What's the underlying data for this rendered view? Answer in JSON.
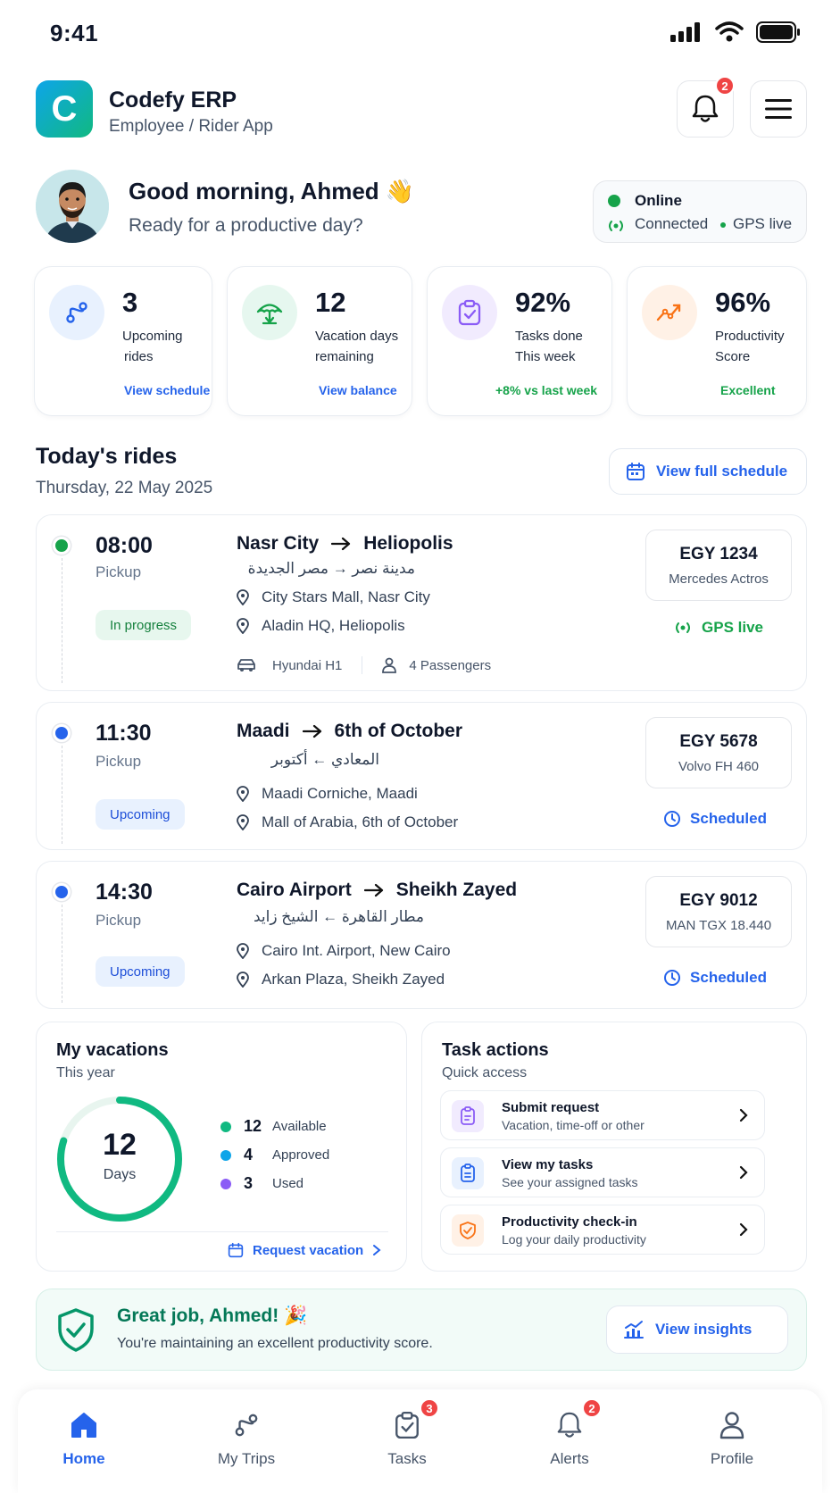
{
  "status_bar": {
    "time": "9:41"
  },
  "header": {
    "app_name": "Codefy ERP",
    "app_subtitle": "Employee / Rider App",
    "notification_count": "2",
    "logo_letter": "C"
  },
  "greeting": {
    "title": "Good morning, Ahmed 👋",
    "subtitle": "Ready for a productive day?"
  },
  "connection": {
    "status": "Online",
    "connected": "Connected",
    "gps": "GPS live"
  },
  "stats": [
    {
      "value": "3",
      "label_1": "Upcoming",
      "label_2": "rides",
      "link": "View schedule",
      "icon": "route-icon"
    },
    {
      "value": "12",
      "label_1": "Vacation days",
      "label_2": "remaining",
      "link": "View balance",
      "icon": "umbrella-icon"
    },
    {
      "value": "92%",
      "label_1": "Tasks done",
      "label_2": "This week",
      "link": "+8% vs last week",
      "icon": "clipboard-check-icon"
    },
    {
      "value": "96%",
      "label_1": "Productivity",
      "label_2": "Score",
      "link": "Excellent",
      "icon": "trend-icon"
    }
  ],
  "rides_section": {
    "title": "Today's rides",
    "date": "Thursday, 22 May 2025",
    "view_full": "View full schedule"
  },
  "rides": [
    {
      "time": "08:00",
      "pickup_label": "Pickup",
      "status": "In progress",
      "from": "Nasr City",
      "to": "Heliopolis",
      "arabic": "مدينة نصر → مصر الجديدة",
      "loc_from": "City Stars Mall, Nasr City",
      "loc_to": "Aladin HQ, Heliopolis",
      "vehicle": "Hyundai H1",
      "passengers": "4 Passengers",
      "plate": "EGY 1234",
      "truck": "Mercedes Actros",
      "tracking": "GPS live"
    },
    {
      "time": "11:30",
      "pickup_label": "Pickup",
      "status": "Upcoming",
      "from": "Maadi",
      "to": "6th of October",
      "arabic": "المعادي ← أكتوبر",
      "loc_from": "Maadi Corniche, Maadi",
      "loc_to": "Mall of Arabia, 6th of October",
      "plate": "EGY 5678",
      "truck": "Volvo FH 460",
      "tracking": "Scheduled"
    },
    {
      "time": "14:30",
      "pickup_label": "Pickup",
      "status": "Upcoming",
      "from": "Cairo Airport",
      "to": "Sheikh Zayed",
      "arabic": "مطار القاهرة ← الشيخ زايد",
      "loc_from": "Cairo Int. Airport, New Cairo",
      "loc_to": "Arkan Plaza, Sheikh Zayed",
      "plate": "EGY 9012",
      "truck": "MAN TGX 18.440",
      "tracking": "Scheduled"
    }
  ],
  "vacations": {
    "title": "My vacations",
    "subtitle": "This year",
    "total": "12",
    "unit": "Days",
    "available": "12",
    "available_label": "Available",
    "approved": "4",
    "approved_label": "Approved",
    "used": "3",
    "used_label": "Used",
    "request": "Request vacation",
    "ring_fill_fraction": 0.8
  },
  "task_actions": {
    "title": "Task actions",
    "subtitle": "Quick access",
    "items": [
      {
        "title": "Submit request",
        "subtitle": "Vacation, time-off or other"
      },
      {
        "title": "View my tasks",
        "subtitle": "See your assigned tasks"
      },
      {
        "title": "Productivity check-in",
        "subtitle": "Log your daily productivity"
      }
    ]
  },
  "banner": {
    "title": "Great job, Ahmed! 🎉",
    "subtitle": "You're maintaining an excellent productivity score.",
    "button": "View insights"
  },
  "tabs": [
    {
      "label": "Home",
      "active": true
    },
    {
      "label": "My Trips"
    },
    {
      "label": "Tasks",
      "badge": "3"
    },
    {
      "label": "Alerts",
      "badge": "2"
    },
    {
      "label": "Profile"
    }
  ],
  "colors": {
    "primary": "#2563eb",
    "green": "#16a34a",
    "accent_green": "#10b981",
    "danger": "#ef4444",
    "purple": "#8b5cf6",
    "orange": "#f97316"
  }
}
